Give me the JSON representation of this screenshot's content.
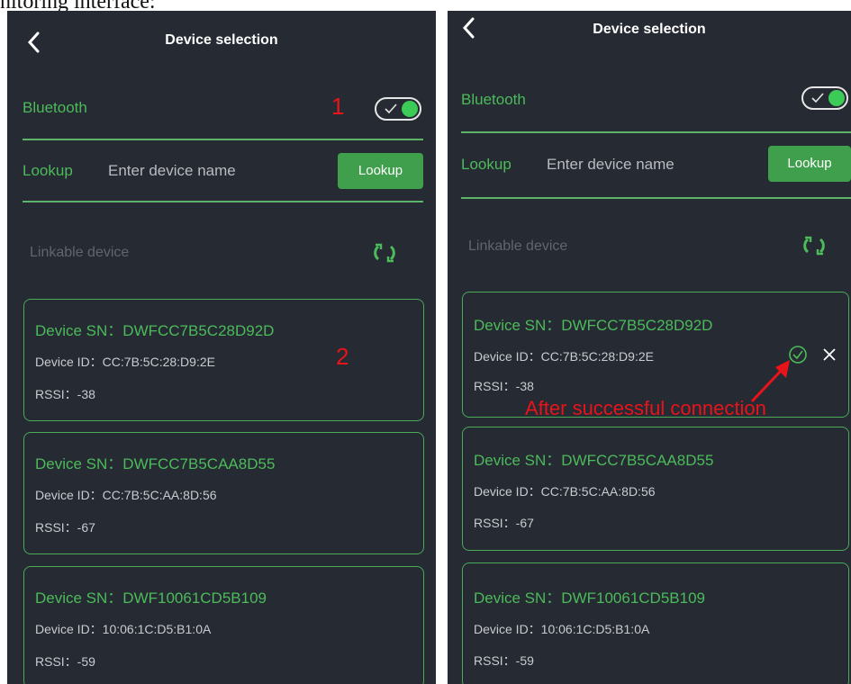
{
  "caption": "nitoring interface:",
  "colors": {
    "background": "#252a33",
    "accent": "#4cbb5a",
    "button": "#3f9f4c",
    "annotation": "#e8141a"
  },
  "screens": [
    {
      "title": "Device selection",
      "bluetooth_label": "Bluetooth",
      "bluetooth_on": true,
      "lookup_label": "Lookup",
      "search_placeholder": "Enter device name",
      "lookup_button": "Lookup",
      "linkable_label": "Linkable device",
      "devices": [
        {
          "sn": "Device SN：DWFCC7B5C28D92D",
          "id": "Device ID：CC:7B:5C:28:D9:2E",
          "rssi": "RSSI：-38"
        },
        {
          "sn": "Device SN：DWFCC7B5CAA8D55",
          "id": "Device ID：CC:7B:5C:AA:8D:56",
          "rssi": "RSSI：-67"
        },
        {
          "sn": "Device SN：DWF10061CD5B109",
          "id": "Device ID：10:06:1C:D5:B1:0A",
          "rssi": "RSSI：-59"
        }
      ],
      "markers": {
        "toggle": "1",
        "device": "2"
      }
    },
    {
      "title": "Device selection",
      "bluetooth_label": "Bluetooth",
      "bluetooth_on": true,
      "lookup_label": "Lookup",
      "search_placeholder": "Enter device name",
      "lookup_button": "Lookup",
      "linkable_label": "Linkable device",
      "devices": [
        {
          "sn": "Device SN：DWFCC7B5C28D92D",
          "id": "Device ID：CC:7B:5C:28:D9:2E",
          "rssi": "RSSI：-38",
          "connected": true
        },
        {
          "sn": "Device SN：DWFCC7B5CAA8D55",
          "id": "Device ID：CC:7B:5C:AA:8D:56",
          "rssi": "RSSI：-67"
        },
        {
          "sn": "Device SN：DWF10061CD5B109",
          "id": "Device ID：10:06:1C:D5:B1:0A",
          "rssi": "RSSI：-59"
        }
      ],
      "annotation": "After successful connection"
    }
  ],
  "icons": [
    "back-icon",
    "toggle-check-icon",
    "refresh-icon",
    "connected-check-icon",
    "close-icon",
    "arrow-icon"
  ]
}
